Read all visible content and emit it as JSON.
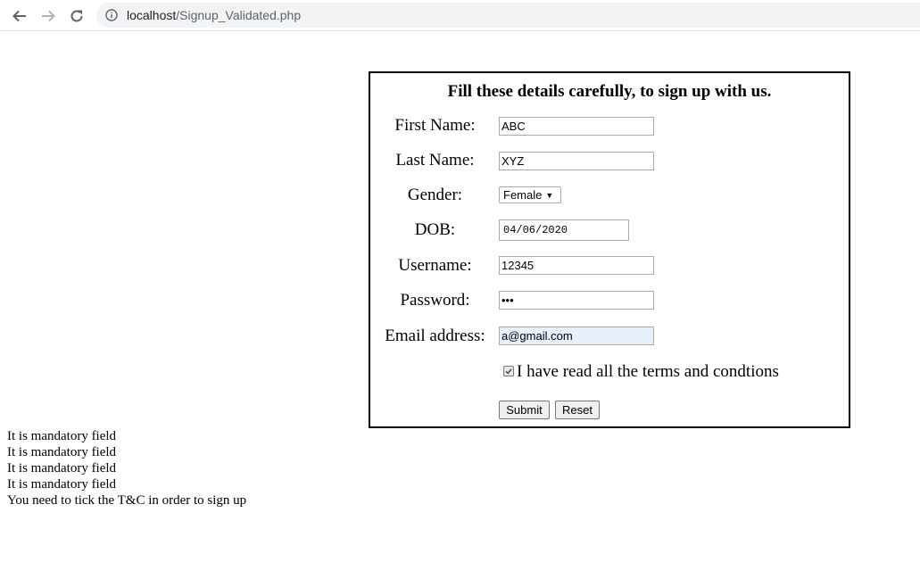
{
  "browser": {
    "url_host": "localhost",
    "url_path": "/Signup_Validated.php"
  },
  "form": {
    "title": "Fill these details carefully, to sign up with us.",
    "first_name": {
      "label": "First Name:",
      "value": "ABC"
    },
    "last_name": {
      "label": "Last Name:",
      "value": "XYZ"
    },
    "gender": {
      "label": "Gender:",
      "value": "Female"
    },
    "dob": {
      "label": "DOB:",
      "value": "04/06/2020"
    },
    "username": {
      "label": "Username:",
      "value": "12345"
    },
    "password": {
      "label": "Password:",
      "value": "•••"
    },
    "email": {
      "label": "Email address:",
      "value": "a@gmail.com"
    },
    "terms": {
      "label": "I have read all the terms and condtions",
      "checked": true
    },
    "submit_label": "Submit",
    "reset_label": "Reset"
  },
  "errors": [
    "It is mandatory field",
    "It is mandatory field",
    "It is mandatory field",
    "It is mandatory field",
    "You need to tick the T&C in order to sign up"
  ]
}
